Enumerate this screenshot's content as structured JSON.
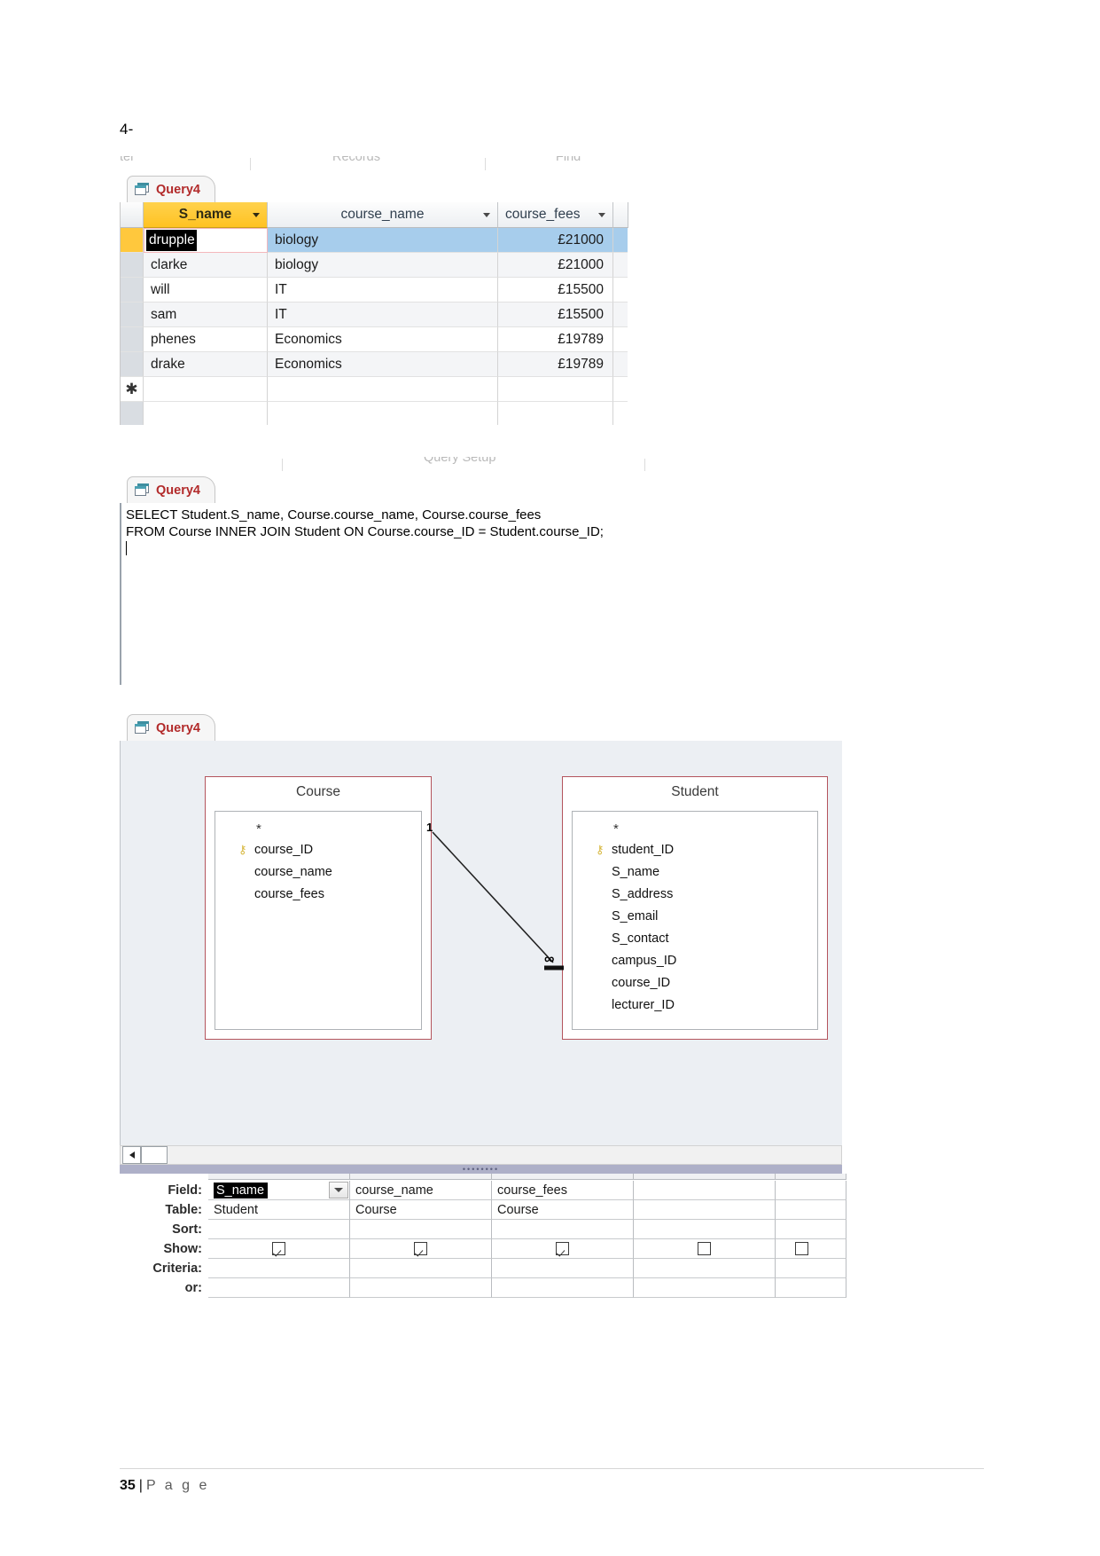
{
  "step_label": "4-",
  "ribbon": {
    "groups": [
      "ter",
      "Records",
      "Find"
    ],
    "query_setup_label": "Query Setup"
  },
  "datasheet": {
    "tab_label": "Query4",
    "columns": [
      "S_name",
      "course_name",
      "course_fees"
    ],
    "rows": [
      {
        "S_name": "drupple",
        "course_name": "biology",
        "course_fees": "£21000"
      },
      {
        "S_name": "clarke",
        "course_name": "biology",
        "course_fees": "£21000"
      },
      {
        "S_name": "will",
        "course_name": "IT",
        "course_fees": "£15500"
      },
      {
        "S_name": "sam",
        "course_name": "IT",
        "course_fees": "£15500"
      },
      {
        "S_name": "phenes",
        "course_name": "Economics",
        "course_fees": "£19789"
      },
      {
        "S_name": "drake",
        "course_name": "Economics",
        "course_fees": "£19789"
      }
    ],
    "new_row_marker": "✱",
    "editing_cell_value": "drupple",
    "selected_row_index": 0
  },
  "sql_view": {
    "tab_label": "Query4",
    "line1": "SELECT Student.S_name, Course.course_name, Course.course_fees",
    "line2": "FROM Course INNER JOIN Student ON Course.course_ID = Student.course_ID;"
  },
  "design_view": {
    "tab_label": "Query4",
    "tables": [
      {
        "name": "Course",
        "star": "*",
        "fields": [
          {
            "label": "course_ID",
            "key": true
          },
          {
            "label": "course_name",
            "key": false
          },
          {
            "label": "course_fees",
            "key": false
          }
        ]
      },
      {
        "name": "Student",
        "star": "*",
        "fields": [
          {
            "label": "student_ID",
            "key": true
          },
          {
            "label": "S_name",
            "key": false
          },
          {
            "label": "S_address",
            "key": false
          },
          {
            "label": "S_email",
            "key": false
          },
          {
            "label": "S_contact",
            "key": false
          },
          {
            "label": "campus_ID",
            "key": false
          },
          {
            "label": "course_ID",
            "key": false
          },
          {
            "label": "lecturer_ID",
            "key": false
          }
        ]
      }
    ],
    "relationship": {
      "one_label": "1",
      "many_label": "∞"
    },
    "key_glyph": "⚷"
  },
  "query_grid": {
    "row_labels": [
      "Field:",
      "Table:",
      "Sort:",
      "Show:",
      "Criteria:",
      "or:"
    ],
    "columns": [
      {
        "field": "S_name",
        "table": "Student",
        "sort": "",
        "show": true,
        "criteria": "",
        "or": "",
        "selected": true,
        "has_dropdown": true
      },
      {
        "field": "course_name",
        "table": "Course",
        "sort": "",
        "show": true,
        "criteria": "",
        "or": "",
        "selected": false,
        "has_dropdown": false
      },
      {
        "field": "course_fees",
        "table": "Course",
        "sort": "",
        "show": true,
        "criteria": "",
        "or": "",
        "selected": false,
        "has_dropdown": false
      },
      {
        "field": "",
        "table": "",
        "sort": "",
        "show": false,
        "criteria": "",
        "or": "",
        "selected": false,
        "has_dropdown": false
      },
      {
        "field": "",
        "table": "",
        "sort": "",
        "show": false,
        "criteria": "",
        "or": "",
        "selected": false,
        "has_dropdown": false
      }
    ]
  },
  "footer": {
    "page_number": "35",
    "separator": "|",
    "page_word": "P a g e"
  }
}
